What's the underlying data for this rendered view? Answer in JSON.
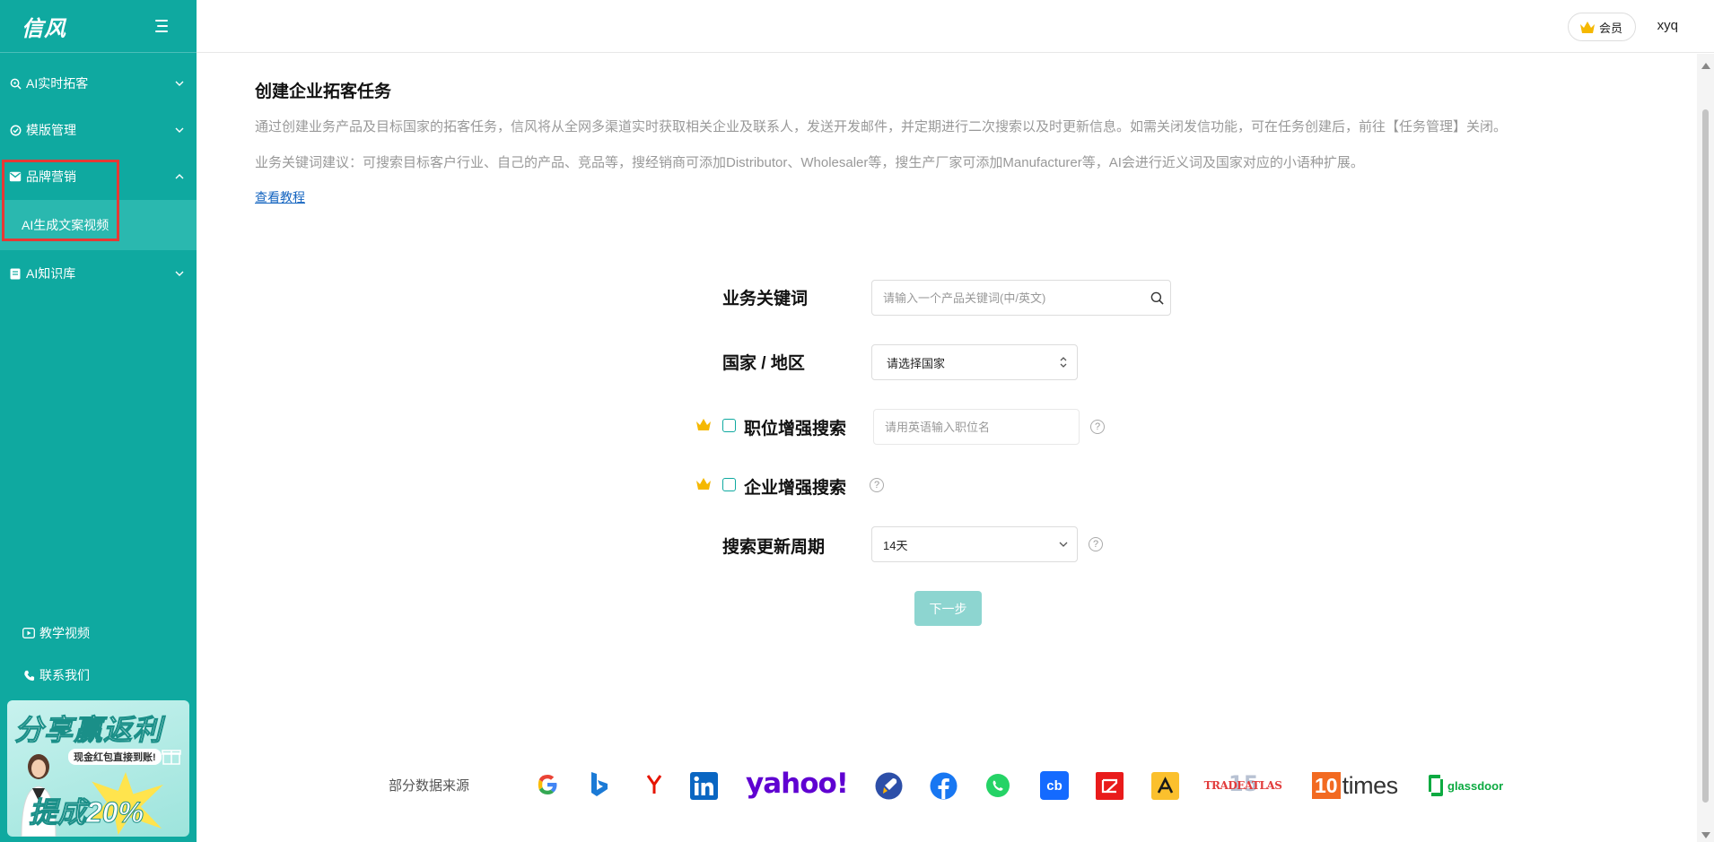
{
  "app": {
    "logo": "信风"
  },
  "sidebar": {
    "items": [
      {
        "label": "AI实时拓客",
        "icon": "search-icon"
      },
      {
        "label": "模版管理",
        "icon": "check-circle-icon"
      },
      {
        "label": "品牌营销",
        "icon": "mail-icon",
        "expanded": true,
        "sub": [
          "AI生成文案视频"
        ]
      },
      {
        "label": "AI知识库",
        "icon": "book-icon"
      }
    ],
    "bottom": {
      "tutorial_video": "教学视频",
      "contact": "联系我们"
    },
    "promo": {
      "title": "分享赢返利",
      "subtitle": "现金红包直接到账!",
      "rate": "提成20%"
    }
  },
  "header": {
    "vip_label": "会员",
    "username": "xyq"
  },
  "main": {
    "title": "创建企业拓客任务",
    "desc1": "通过创建业务产品及目标国家的拓客任务，信风将从全网多渠道实时获取相关企业及联系人，发送开发邮件，并定期进行二次搜索以及时更新信息。如需关闭发信功能，可在任务创建后，前往【任务管理】关闭。",
    "desc2": "业务关键词建议：可搜索目标客户行业、自己的产品、竞品等，搜经销商可添加Distributor、Wholesaler等，搜生产厂家可添加Manufacturer等，AI会进行近义词及国家对应的小语种扩展。",
    "tutorial_link": "查看教程"
  },
  "form": {
    "keyword_label": "业务关键词",
    "keyword_placeholder": "请输入一个产品关键词(中/英文)",
    "country_label": "国家 / 地区",
    "country_value": "请选择国家",
    "position_label": "职位增强搜索",
    "position_placeholder": "请用英语输入职位名",
    "company_label": "企业增强搜索",
    "period_label": "搜索更新周期",
    "period_value": "14天",
    "next_label": "下一步"
  },
  "sources": {
    "label": "部分数据来源",
    "yahoo": "yahoo!",
    "cb": "cb",
    "tradeatlas": "TRADEATLAS",
    "tradeatlas_badge": "15",
    "tentimes_num": "10",
    "tentimes_word": "times",
    "glassdoor": "glassdoor"
  },
  "colors": {
    "sidebar": "#0fa9a0",
    "accent": "#0fa9a0",
    "button_disabled": "#8dd5d0",
    "crown": "#f5b800",
    "highlight": "#e53935"
  }
}
